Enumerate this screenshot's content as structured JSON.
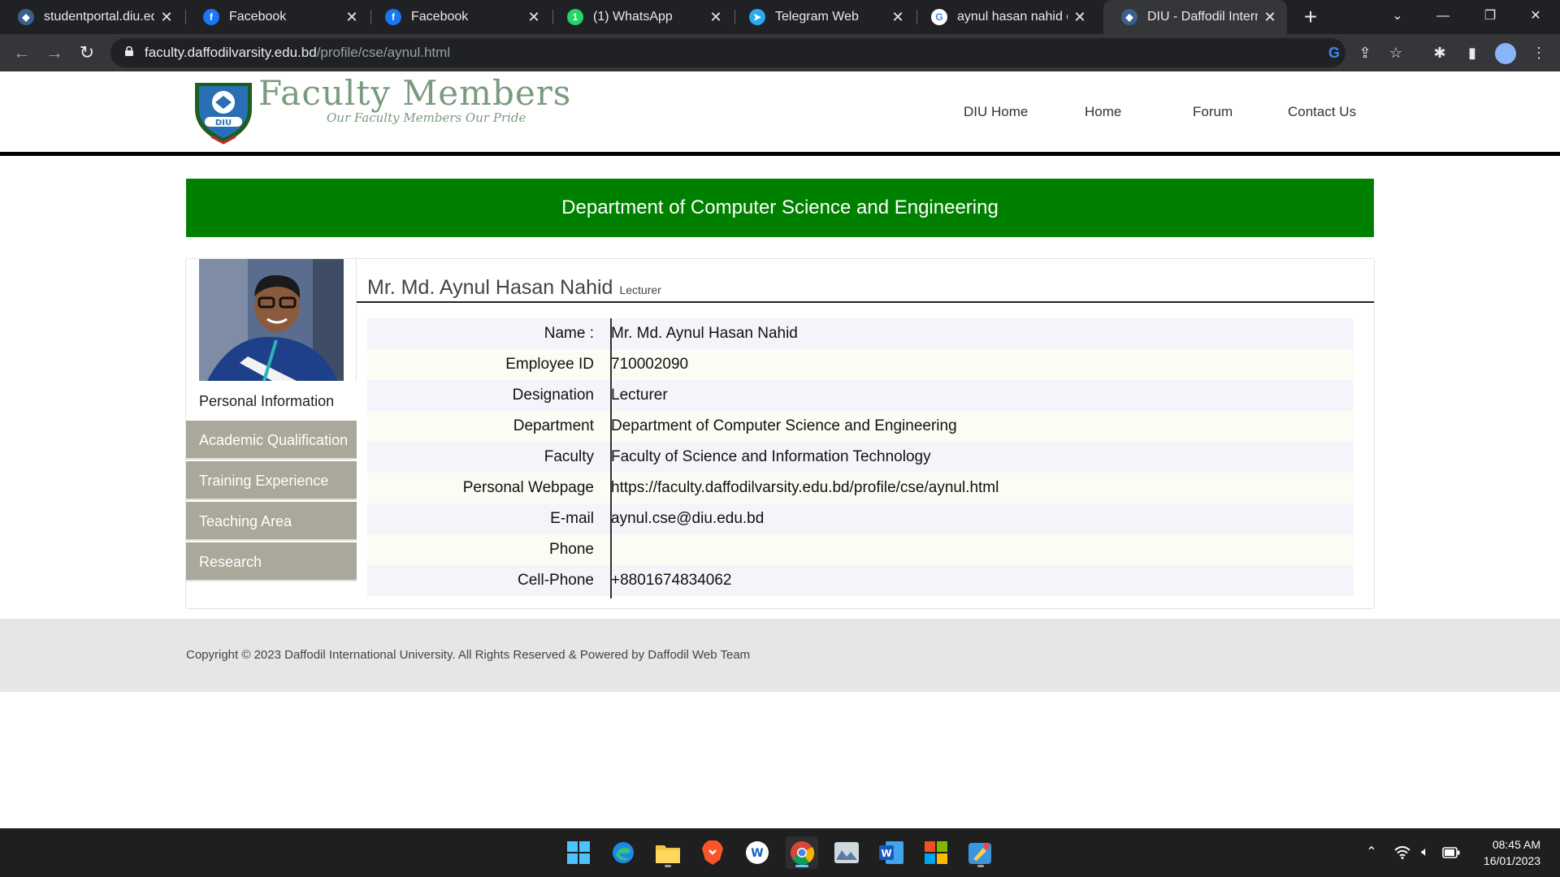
{
  "browser": {
    "tabs": [
      {
        "title": "studentportal.diu.edu",
        "icon": "diu-favicon",
        "active": false
      },
      {
        "title": "Facebook",
        "icon": "facebook-favicon",
        "active": false
      },
      {
        "title": "Facebook",
        "icon": "facebook-favicon",
        "active": false
      },
      {
        "title": "(1) WhatsApp",
        "icon": "whatsapp-favicon",
        "active": false
      },
      {
        "title": "Telegram Web",
        "icon": "telegram-favicon",
        "active": false
      },
      {
        "title": "aynul hasan nahid diu",
        "icon": "google-favicon",
        "active": false
      },
      {
        "title": "DIU - Daffodil Interna",
        "icon": "diu-favicon",
        "active": true
      }
    ],
    "url_host": "faculty.daffodilvarsity.edu.bd",
    "url_path": "/profile/cse/aynul.html"
  },
  "site": {
    "logo_title": "Faculty Members",
    "logo_tagline": "Our Faculty Members Our Pride",
    "logo_badge_text": "DIU",
    "nav": [
      "DIU Home",
      "Home",
      "Forum",
      "Contact Us"
    ]
  },
  "banner": {
    "text": "Department of Computer Science and Engineering",
    "color": "#008000"
  },
  "profile": {
    "name": "Mr. Md. Aynul Hasan Nahid",
    "designation_short": "Lecturer",
    "menu": [
      {
        "label": "Personal Information",
        "active": true
      },
      {
        "label": "Academic Qualification",
        "active": false
      },
      {
        "label": "Training Experience",
        "active": false
      },
      {
        "label": "Teaching Area",
        "active": false
      },
      {
        "label": "Research",
        "active": false
      }
    ],
    "info": [
      {
        "label": "Name :",
        "value": "Mr. Md. Aynul Hasan Nahid"
      },
      {
        "label": "Employee ID",
        "value": "710002090"
      },
      {
        "label": "Designation",
        "value": "Lecturer"
      },
      {
        "label": "Department",
        "value": "Department of Computer Science and Engineering"
      },
      {
        "label": "Faculty",
        "value": "Faculty of Science and Information Technology"
      },
      {
        "label": "Personal Webpage",
        "value": "https://faculty.daffodilvarsity.edu.bd/profile/cse/aynul.html"
      },
      {
        "label": "E-mail",
        "value": "aynul.cse@diu.edu.bd"
      },
      {
        "label": "Phone",
        "value": ""
      },
      {
        "label": "Cell-Phone",
        "value": "+8801674834062"
      }
    ]
  },
  "footer": {
    "text": "Copyright © 2023 Daffodil International University. All Rights Reserved & Powered by Daffodil Web Team"
  },
  "taskbar": {
    "apps": [
      "start-menu",
      "edge",
      "file-explorer",
      "brave",
      "app-w",
      "chrome",
      "photos",
      "word",
      "ms-store",
      "paint"
    ],
    "time": "08:45 AM",
    "date": "16/01/2023"
  },
  "colors": {
    "row_even": "#f7f3fa",
    "row_odd": "#fbfcf4",
    "side_menu": "#a9a89a"
  }
}
